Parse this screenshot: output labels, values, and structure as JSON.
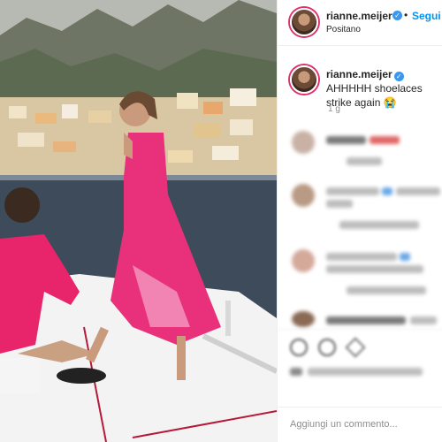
{
  "post": {
    "username": "rianne.meijer",
    "verified_icon": "verified-badge-icon",
    "separator": "•",
    "follow_label": "Segui",
    "location": "Positano",
    "caption_username": "rianne.meijer",
    "caption_text": "AHHHHH shoelaces strike again 😭",
    "time": "1 g",
    "comment_placeholder": "Aggiungi un commento..."
  },
  "colors": {
    "accent": "#0095f6",
    "verified": "#3897f0",
    "dress_pink": "#e8317a",
    "story_ring": "#e1306c"
  }
}
